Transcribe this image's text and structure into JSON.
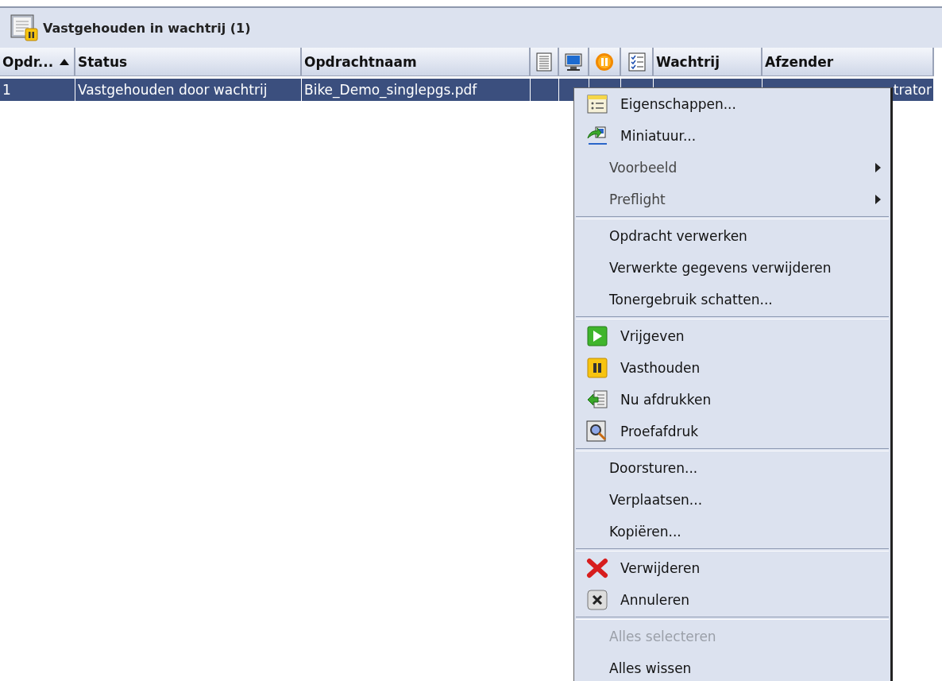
{
  "panel": {
    "title": "Vastgehouden in wachtrij (1)"
  },
  "table": {
    "columns": [
      {
        "kind": "text",
        "label": "Opdr...",
        "sorted": true
      },
      {
        "kind": "text",
        "label": "Status",
        "sorted": false
      },
      {
        "kind": "text",
        "label": "Opdrachtnaam",
        "sorted": false
      },
      {
        "kind": "icon",
        "sorted": false
      },
      {
        "kind": "icon",
        "sorted": false
      },
      {
        "kind": "icon",
        "sorted": false
      },
      {
        "kind": "icon",
        "sorted": false
      },
      {
        "kind": "text",
        "label": "Wachtrij",
        "sorted": false
      },
      {
        "kind": "text",
        "label": "Afzender",
        "sorted": false
      }
    ],
    "rows": [
      {
        "selected": true,
        "cells": [
          "1",
          "Vastgehouden door wachtrij",
          "Bike_Demo_singlepgs.pdf",
          "",
          "",
          "",
          "",
          "",
          "trator"
        ]
      }
    ]
  },
  "context_menu": {
    "items": [
      {
        "kind": "icon-item",
        "label": "Eigenschappen...",
        "disabled": false
      },
      {
        "kind": "icon-item",
        "label": "Miniatuur...",
        "disabled": false
      },
      {
        "kind": "submenu",
        "label": "Voorbeeld",
        "disabled": false
      },
      {
        "kind": "submenu",
        "label": "Preflight",
        "disabled": false
      },
      {
        "kind": "separator"
      },
      {
        "kind": "item",
        "label": "Opdracht verwerken",
        "disabled": false
      },
      {
        "kind": "item",
        "label": "Verwerkte gegevens verwijderen",
        "disabled": false
      },
      {
        "kind": "item",
        "label": "Tonergebruik schatten...",
        "disabled": false
      },
      {
        "kind": "separator"
      },
      {
        "kind": "icon-item",
        "label": "Vrijgeven",
        "disabled": false
      },
      {
        "kind": "icon-item",
        "label": "Vasthouden",
        "disabled": false
      },
      {
        "kind": "icon-item",
        "label": "Nu afdrukken",
        "disabled": false
      },
      {
        "kind": "icon-item",
        "label": "Proefafdruk",
        "disabled": false
      },
      {
        "kind": "separator"
      },
      {
        "kind": "item",
        "label": "Doorsturen...",
        "disabled": false
      },
      {
        "kind": "item",
        "label": "Verplaatsen...",
        "disabled": false
      },
      {
        "kind": "item",
        "label": "Kopiëren...",
        "disabled": false
      },
      {
        "kind": "separator"
      },
      {
        "kind": "icon-item",
        "label": "Verwijderen",
        "disabled": false
      },
      {
        "kind": "icon-item",
        "label": "Annuleren",
        "disabled": false
      },
      {
        "kind": "separator"
      },
      {
        "kind": "item",
        "label": "Alles selecteren",
        "disabled": true
      },
      {
        "kind": "item",
        "label": "Alles wissen",
        "disabled": false
      }
    ]
  }
}
